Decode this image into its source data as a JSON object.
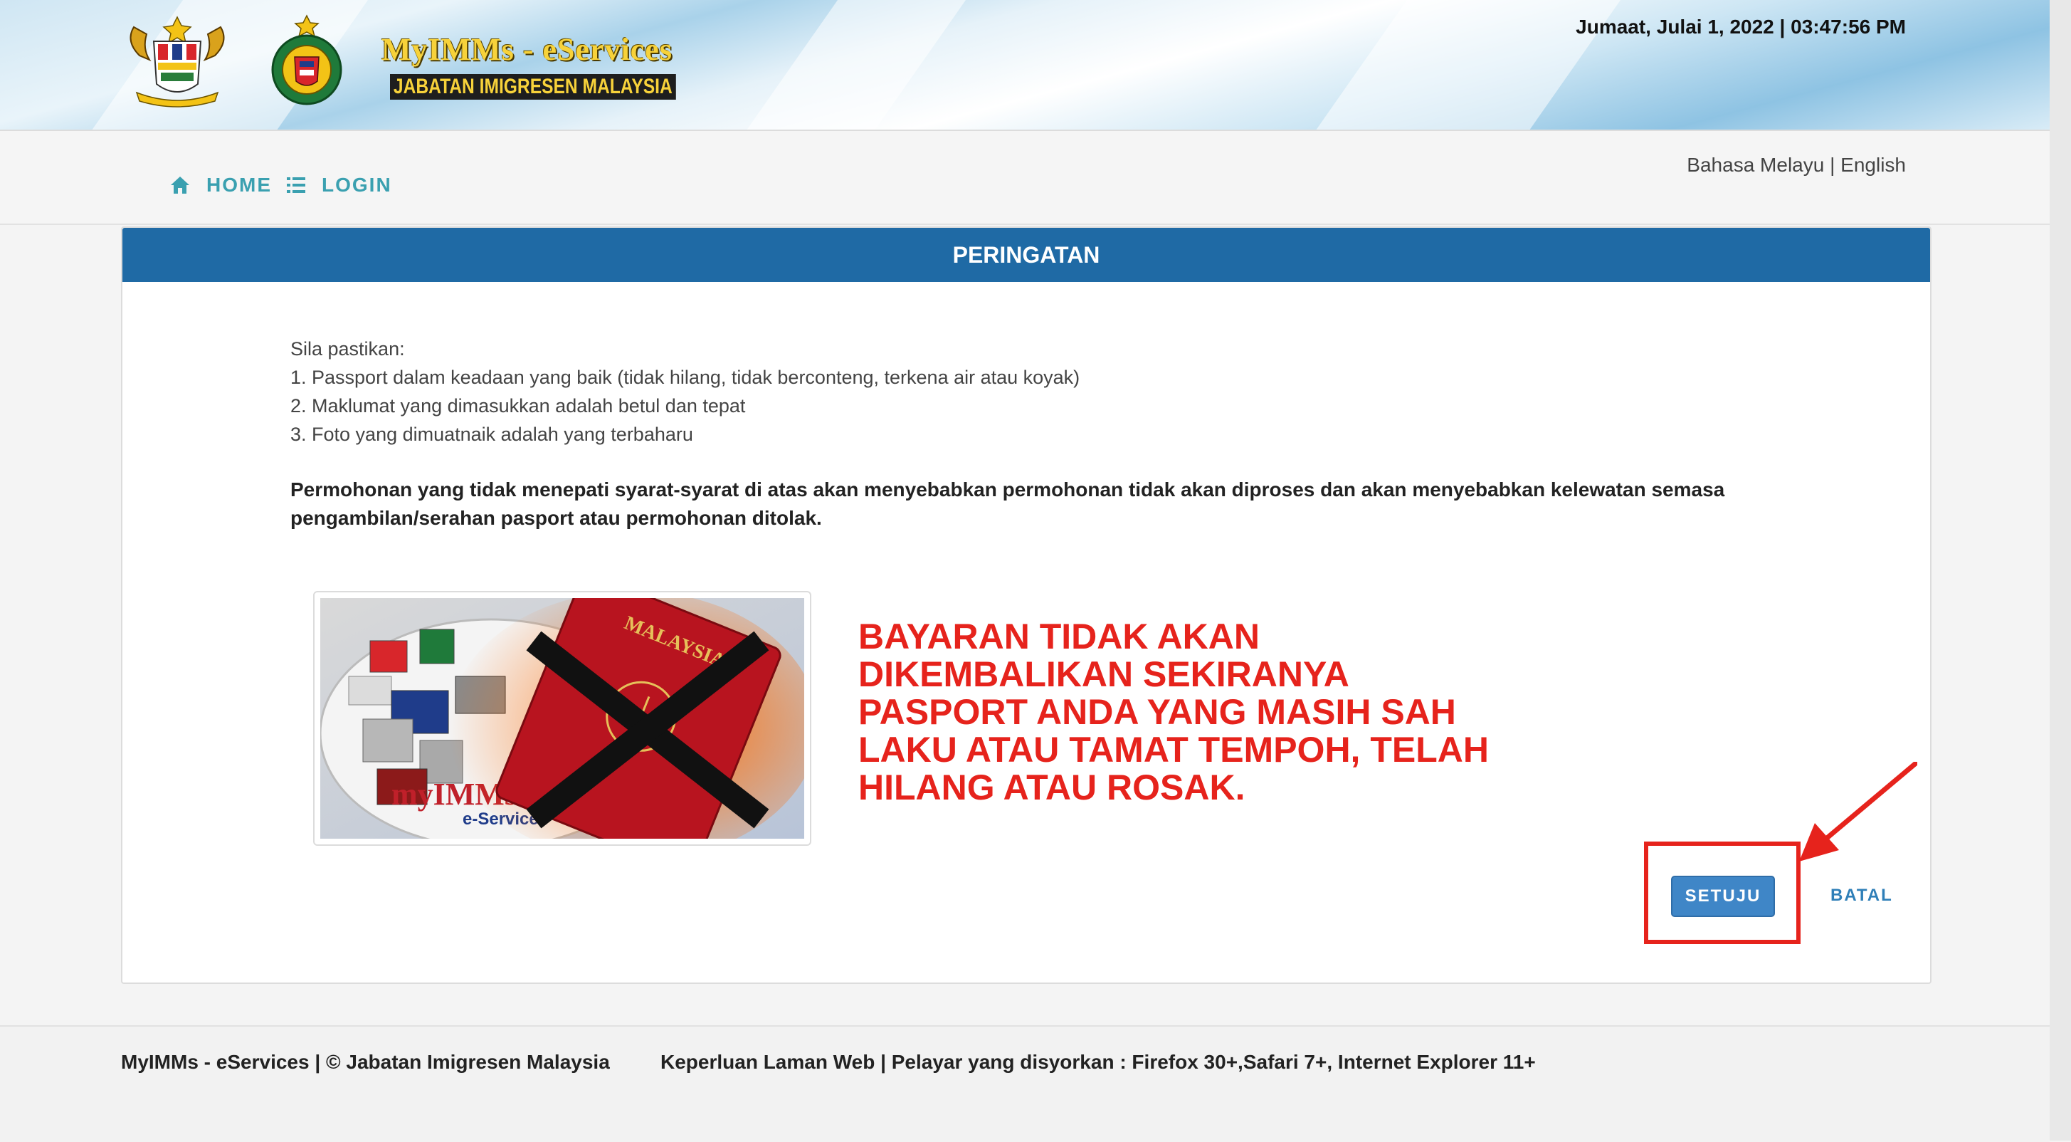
{
  "header": {
    "brand_title": "MyIMMs - eServices",
    "brand_subtitle": "JABATAN IMIGRESEN MALAYSIA",
    "datetime": "Jumaat, Julai 1, 2022 | 03:47:56 PM"
  },
  "nav": {
    "home_label": "HOME",
    "login_label": "LOGIN",
    "lang_malay": "Bahasa Melayu",
    "lang_separator": " | ",
    "lang_english": "English"
  },
  "panel": {
    "title": "PERINGATAN",
    "intro_heading": "Sila pastikan:",
    "items": [
      "1. Passport dalam keadaan yang baik (tidak hilang, tidak berconteng, terkena air atau koyak)",
      "2. Maklumat yang dimasukkan adalah betul dan tepat",
      "3. Foto yang dimuatnaik adalah yang terbaharu"
    ],
    "warning": "Permohonan yang tidak menepati syarat-syarat di atas akan menyebabkan permohonan tidak akan diproses dan akan menyebabkan kelewatan semasa pengambilan/serahan pasport atau permohonan ditolak.",
    "red_notice": "BAYARAN TIDAK AKAN DIKEMBALIKAN SEKIRANYA PASPORT ANDA YANG MASIH SAH LAKU ATAU TAMAT TEMPOH, TELAH HILANG ATAU ROSAK.",
    "agree_label": "SETUJU",
    "cancel_label": "BATAL",
    "promo_text": "myIMMs",
    "promo_sub": "e-Service",
    "passport_text": "MALAYSIA"
  },
  "footer": {
    "left": "MyIMMs - eServices | © Jabatan Imigresen Malaysia",
    "right": "Keperluan Laman Web | Pelayar yang disyorkan : Firefox 30+,Safari 7+, Internet Explorer 11+"
  },
  "colors": {
    "panel_header": "#1f6aa5",
    "nav_accent": "#3aa0b0",
    "alert_red": "#e6231c",
    "button_blue": "#3f86c7",
    "brand_gold": "#f7d23a"
  }
}
